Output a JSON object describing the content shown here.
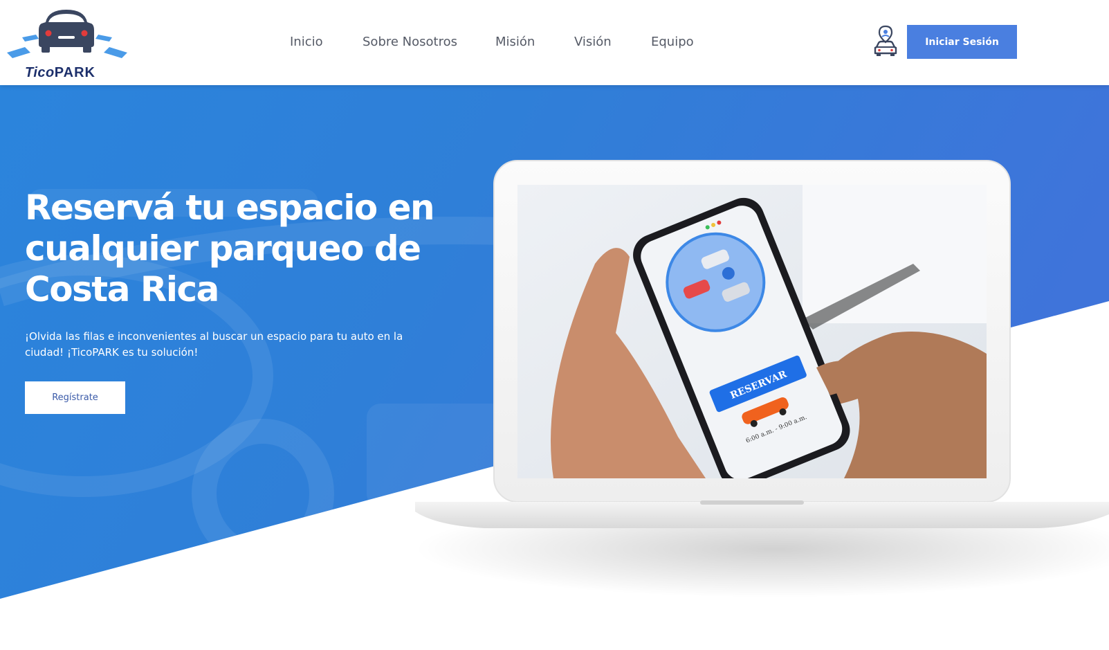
{
  "brand": {
    "name_part1": "Tico",
    "name_part2": "PARK"
  },
  "nav": {
    "items": [
      "Inicio",
      "Sobre Nosotros",
      "Misión",
      "Visión",
      "Equipo"
    ]
  },
  "header": {
    "user_icon": "user-location-car-icon",
    "login_label": "Iniciar Sesión"
  },
  "hero": {
    "title": "Reservá tu espacio en cualquier parqueo de Costa Rica",
    "description": "¡Olvida las filas e inconvenientes al buscar un espacio para tu auto en la ciudad! ¡TicoPARK es tu solución!",
    "register_label": "Regístrate"
  },
  "phone_screen": {
    "button_label": "RESERVAR",
    "time_text": "6:00 a.m. - 9:00 a.m."
  },
  "colors": {
    "brand_blue": "#4a7fe0",
    "hero_blue": "#2f7fd8",
    "logo_dark": "#1c2f6b",
    "car_orange": "#f0621e"
  }
}
